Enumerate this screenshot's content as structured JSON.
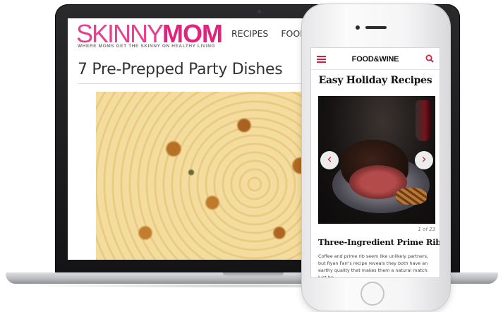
{
  "laptop": {
    "site": {
      "logo_thin": "SKINNY",
      "logo_bold": "MOM",
      "tagline": "WHERE MOMS GET THE SKINNY ON HEALTHY LIVING",
      "nav_items": [
        "RECIPES",
        "FOOD"
      ],
      "page_title": "7 Pre-Prepped Party Dishes"
    },
    "brand_colors": {
      "pink": "#e2237e"
    }
  },
  "phone": {
    "site": {
      "logo": "FOOD&WINE",
      "headline": "Easy Holiday Recipes",
      "slide_counter": "1 of 23",
      "slide_title": "Three-Ingredient Prime Rib Roast",
      "slide_body": "Coffee and prime rib seem like unlikely partners, but Ryan Farr's recipe reveals they both have an earthy quality that makes them a natural match. Just be",
      "prev_icon": "chevron-left-icon",
      "next_icon": "chevron-right-icon",
      "menu_icon": "hamburger-menu-icon",
      "search_icon": "search-icon"
    },
    "brand_colors": {
      "red": "#d21e3c"
    }
  }
}
